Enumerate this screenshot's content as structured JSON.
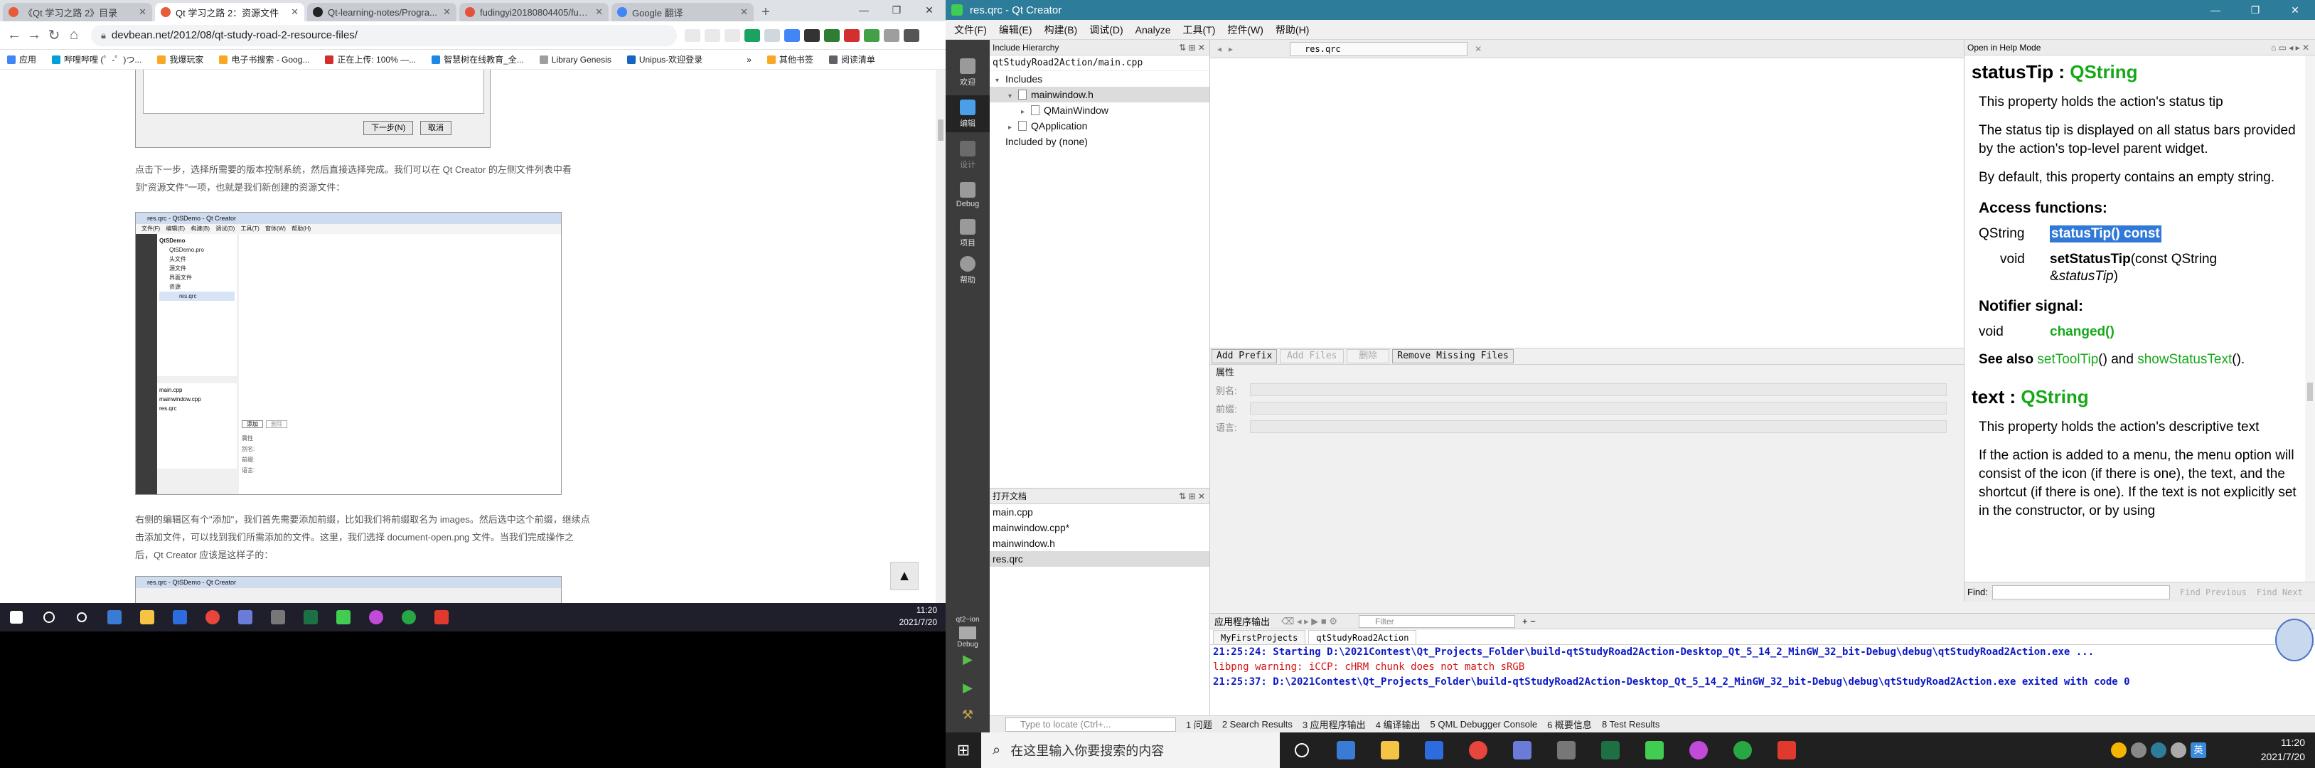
{
  "browser": {
    "tabs": [
      {
        "label": "《Qt 学习之路 2》目录",
        "active": false,
        "color": "#e85b3a"
      },
      {
        "label": "Qt 学习之路 2：资源文件",
        "active": true,
        "color": "#e85b3a"
      },
      {
        "label": "Qt-learning-notes/Progra...",
        "active": false,
        "color": "#222222"
      },
      {
        "label": "fudingyi20180804405/fudi...",
        "active": false,
        "color": "#e8503a"
      },
      {
        "label": "Google 翻译",
        "active": false,
        "color": "#4285f4"
      }
    ],
    "url": "devbean.net/2012/08/qt-study-road-2-resource-files/",
    "bookmarks": [
      "应用",
      "哔哩哔哩 (゜-゜)つ...",
      "我爆玩家",
      "电子书搜索 - Goog...",
      "正在上传: 100% —...",
      "智慧树在线教育_全...",
      "Library Genesis",
      "Unipus-欢迎登录"
    ],
    "bookmarks_right": [
      "其他书签",
      "阅读清单"
    ],
    "dialog_buttons": {
      "next": "下一步(N)",
      "cancel": "取消"
    },
    "para1": "点击下一步，选择所需要的版本控制系统，然后直接选择完成。我们可以在 Qt Creator 的左侧文件列表中看到\"资源文件\"一项，也就是我们新创建的资源文件：",
    "para2": "右侧的编辑区有个\"添加\"，我们首先需要添加前缀，比如我们将前缀取名为 images。然后选中这个前缀，继续点击添加文件，可以找到我们所需添加的文件。这里，我们选择 document-open.png 文件。当我们完成操作之后，Qt Creator 应该是这样子的：",
    "shot_title": "res.qrc - QtSDemo - Qt Creator",
    "shot_menu": "文件(F) 编辑(E) 构建(B) 调试(D) 工具(T) 窗体(W) 帮助(H)",
    "shot_tree": [
      "QtSDemo",
      "QtSDemo.pro",
      "头文件",
      "源文件",
      "界面文件",
      "资源",
      "res.qrc"
    ],
    "shot_files": [
      "main.cpp",
      "mainwindow.cpp",
      "res.qrc"
    ],
    "shot_buttons": [
      "添加",
      "删除"
    ],
    "shot_props": [
      "属性",
      "别名:",
      "前缀:",
      "语言:"
    ],
    "shot2_title": "res.qrc - QtSDemo - Qt Creator",
    "scroll_top": "▲"
  },
  "taskbar_left": {
    "time": "11:20",
    "date": "2021/7/20"
  },
  "qt": {
    "title": "res.qrc - Qt Creator",
    "menu": [
      "文件(F)",
      "编辑(E)",
      "构建(B)",
      "调试(D)",
      "Analyze",
      "工具(T)",
      "控件(W)",
      "帮助(H)"
    ],
    "modes": [
      {
        "label": "欢迎",
        "active": false
      },
      {
        "label": "编辑",
        "active": true
      },
      {
        "label": "设计",
        "active": false
      },
      {
        "label": "Debug",
        "active": false
      },
      {
        "label": "项目",
        "active": false
      },
      {
        "label": "帮助",
        "active": false
      }
    ],
    "kit": "qt2~ion",
    "kit_mode": "Debug",
    "hierarchy": {
      "header": "Include Hierarchy",
      "file": "qtStudyRoad2Action/main.cpp",
      "tree": [
        {
          "label": "Includes",
          "depth": 0,
          "arrow": "▾",
          "sel": false,
          "icon": false
        },
        {
          "label": "mainwindow.h",
          "depth": 1,
          "arrow": "▾",
          "sel": true,
          "icon": true
        },
        {
          "label": "QMainWindow",
          "depth": 2,
          "arrow": "▸",
          "sel": false,
          "icon": true
        },
        {
          "label": "QApplication",
          "depth": 1,
          "arrow": "▸",
          "sel": false,
          "icon": true
        },
        {
          "label": "Included by (none)",
          "depth": 0,
          "arrow": "",
          "sel": false,
          "icon": false
        }
      ]
    },
    "opendocs": {
      "header": "打开文档",
      "docs": [
        {
          "label": "main.cpp",
          "sel": false
        },
        {
          "label": "mainwindow.cpp*",
          "sel": false
        },
        {
          "label": "mainwindow.h",
          "sel": false
        },
        {
          "label": "res.qrc",
          "sel": true
        }
      ]
    },
    "editor_file": "res.qrc",
    "resource_buttons": [
      {
        "label": "Add Prefix",
        "disabled": false
      },
      {
        "label": "Add Files",
        "disabled": true
      },
      {
        "label": "删除",
        "disabled": true
      },
      {
        "label": "Remove Missing Files",
        "disabled": false
      }
    ],
    "properties": {
      "title": "属性",
      "fields": [
        "别名:",
        "前缀:",
        "语言:"
      ]
    },
    "help": {
      "toolbar": "Open in Help Mode",
      "sections": {
        "statusTip_name": "statusTip",
        "statusTip_type": "QString",
        "p1": "This property holds the action's status tip",
        "p2": "The status tip is displayed on all status bars provided by the action's top-level parent widget.",
        "p3": "By default, this property contains an empty string.",
        "access": "Access functions:",
        "getter_rt": "QString",
        "getter": "statusTip() const",
        "setter_rt": "void",
        "setter_fn": "setStatusTip",
        "setter_args_a": "(const QString",
        "setter_args_b": "&",
        "setter_args_c": "statusTip",
        "setter_args_d": ")",
        "notifier": "Notifier signal:",
        "sig_rt": "void",
        "sig": "changed()",
        "seealso_lbl": "See also",
        "seealso_1": "setToolTip",
        "seealso_mid": "() and",
        "seealso_2": "showStatusText",
        "seealso_end": "().",
        "text_name": "text",
        "text_type": "QString",
        "p4": "This property holds the action's descriptive text",
        "p5": "If the action is added to a menu, the menu option will consist of the icon (if there is one), the text, and the shortcut (if there is one). If the text is not explicitly set in the constructor, or by using"
      },
      "find_label": "Find:",
      "find_prev": "Find Previous",
      "find_next": "Find Next"
    },
    "output": {
      "header": "应用程序输出",
      "filter_placeholder": "Filter",
      "tabs": [
        "MyFirstProjects",
        "qtStudyRoad2Action"
      ],
      "lines": [
        {
          "text": "21:25:24: Starting D:\\2021Contest\\Qt_Projects_Folder\\build-qtStudyRoad2Action-Desktop_Qt_5_14_2_MinGW_32_bit-Debug\\debug\\qtStudyRoad2Action.exe ...",
          "style": "blue"
        },
        {
          "text": "libpng warning: iCCP: cHRM chunk does not match sRGB",
          "style": "red"
        },
        {
          "text": "21:25:37: D:\\2021Contest\\Qt_Projects_Folder\\build-qtStudyRoad2Action-Desktop_Qt_5_14_2_MinGW_32_bit-Debug\\debug\\qtStudyRoad2Action.exe exited with code 0",
          "style": "blue"
        }
      ]
    },
    "statusbar": {
      "locator_placeholder": "Type to locate (Ctrl+...",
      "panes": [
        "1 问题",
        "2 Search Results",
        "3 应用程序输出",
        "4 编译输出",
        "5 QML Debugger Console",
        "6 概要信息",
        "8 Test Results"
      ]
    }
  },
  "taskbar_right": {
    "search_placeholder": "在这里输入你要搜索的内容",
    "time": "11:20",
    "date": "2021/7/20",
    "ime": "英"
  }
}
